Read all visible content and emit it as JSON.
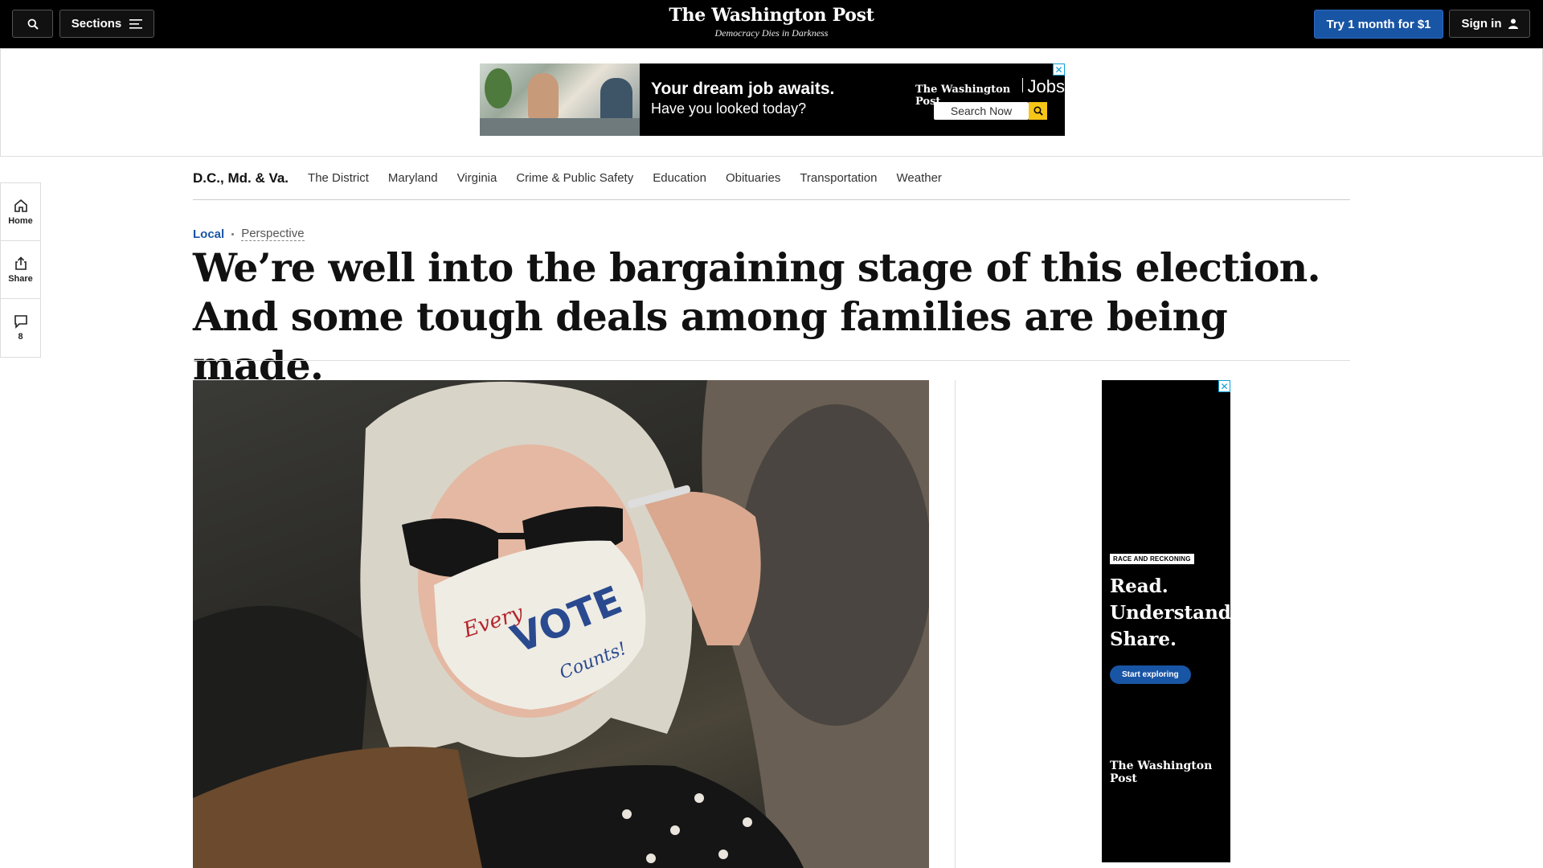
{
  "header": {
    "sections_label": "Sections",
    "logo": "The Washington Post",
    "tagline": "Democracy Dies in Darkness",
    "subscribe_label": "Try 1 month for $1",
    "signin_label": "Sign in"
  },
  "top_ad": {
    "headline": "Your dream job awaits.",
    "subline": "Have you looked today?",
    "brand": "The Washington Post",
    "brand_product": "Jobs",
    "search_label": "Search Now",
    "close": "✕"
  },
  "section_nav": {
    "home": "D.C., Md. & Va.",
    "items": [
      "The District",
      "Maryland",
      "Virginia",
      "Crime & Public Safety",
      "Education",
      "Obituaries",
      "Transportation",
      "Weather"
    ]
  },
  "rail": {
    "home_label": "Home",
    "share_label": "Share",
    "comments_count": "8"
  },
  "article": {
    "section": "Local",
    "label": "Perspective",
    "headline": "We’re well into the bargaining stage of this election. And some tough deals among families are being made.",
    "mask_text_1": "Every",
    "mask_text_2": "VOTE",
    "mask_text_3": "Counts!"
  },
  "side_ad": {
    "tag": "RACE AND RECKONING",
    "line1": "Read.",
    "line2": "Understand.",
    "line3": "Share.",
    "cta": "Start exploring",
    "brand": "The Washington Post",
    "close": "✕"
  },
  "colors": {
    "accent": "#1955a5",
    "topbar": "#000000"
  }
}
